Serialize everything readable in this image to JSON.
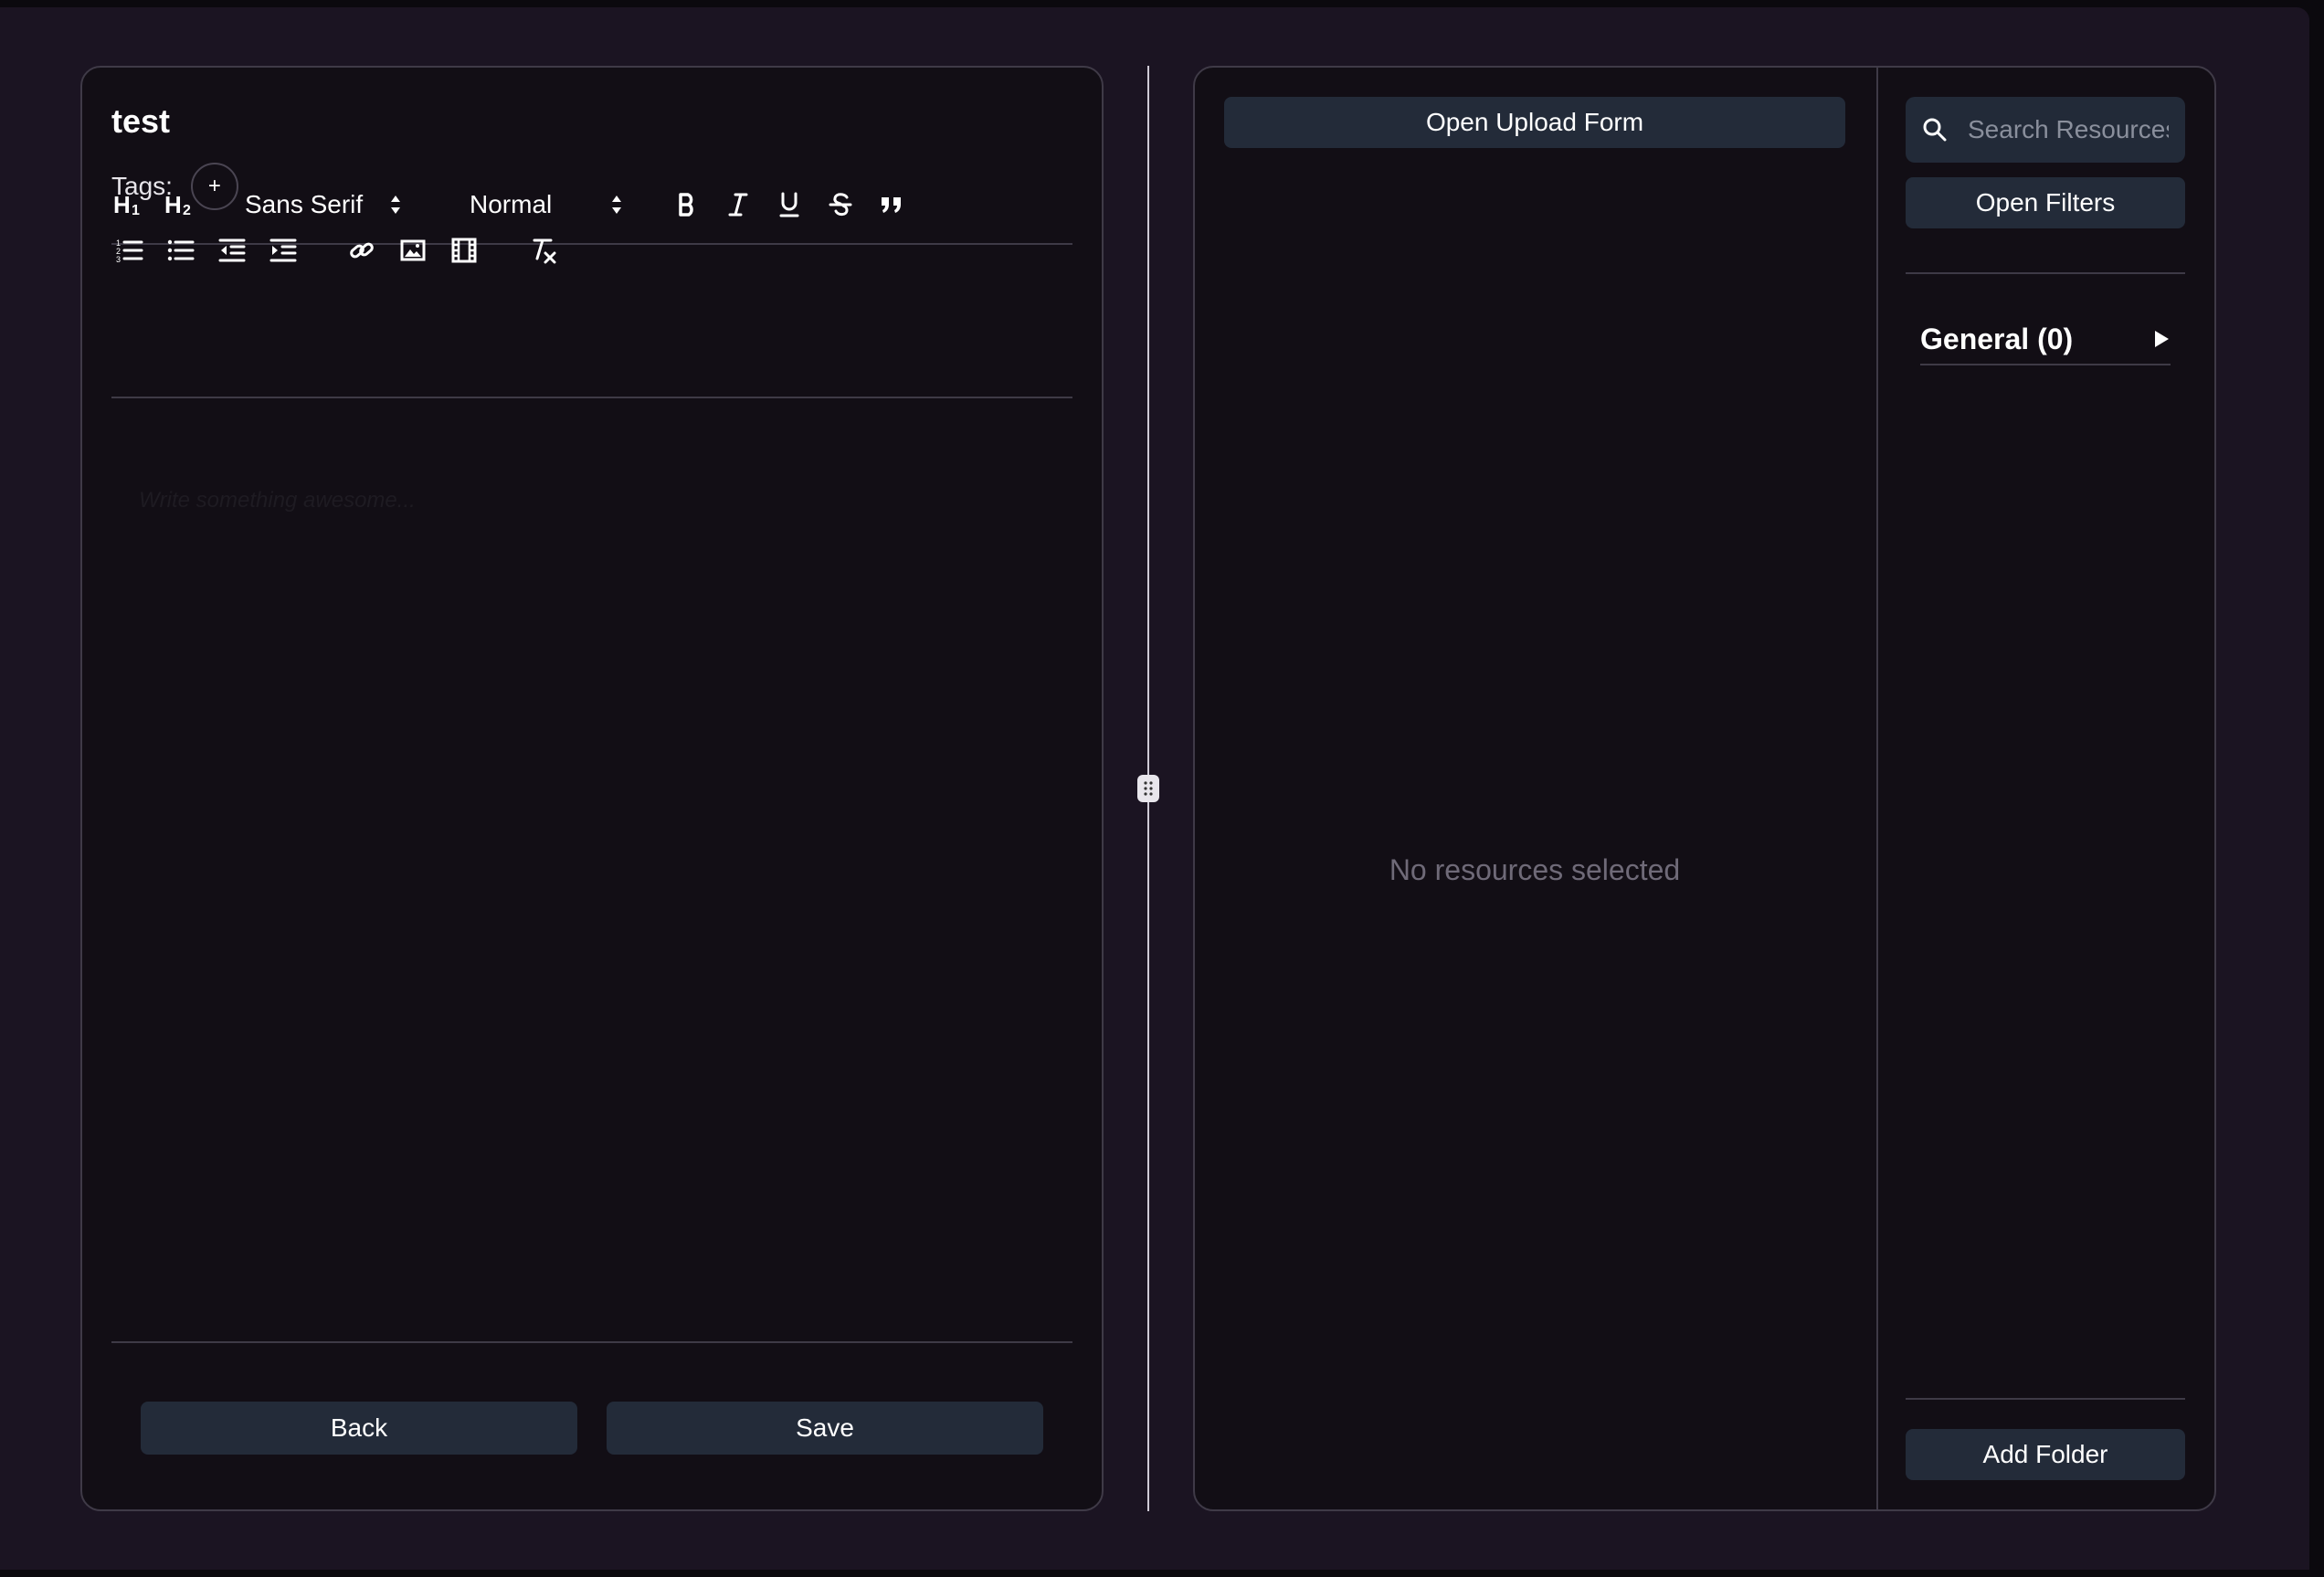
{
  "editor": {
    "title": "test",
    "tags_label": "Tags:",
    "tag_add_label": "+",
    "toolbar": {
      "font_select": "Sans Serif",
      "size_select": "Normal",
      "row1_icons": [
        "heading-1-icon",
        "heading-2-icon",
        "bold-icon",
        "italic-icon",
        "underline-icon",
        "strikethrough-icon",
        "blockquote-icon"
      ],
      "row2_icons": [
        "ordered-list-icon",
        "bullet-list-icon",
        "outdent-icon",
        "indent-icon",
        "link-icon",
        "image-icon",
        "video-icon",
        "clear-format-icon"
      ]
    },
    "placeholder": "Write something awesome..."
  },
  "actions": {
    "back_label": "Back",
    "save_label": "Save"
  },
  "resources": {
    "upload_label": "Open Upload Form",
    "empty_message": "No resources selected",
    "search_placeholder": "Search Resources",
    "filters_label": "Open Filters",
    "folders": [
      {
        "label": "General (0)"
      }
    ],
    "add_folder_label": "Add Folder"
  },
  "colors": {
    "background": "#1b1422",
    "panel": "#120e15",
    "button": "#232b39",
    "muted_text": "#6f6a78"
  }
}
